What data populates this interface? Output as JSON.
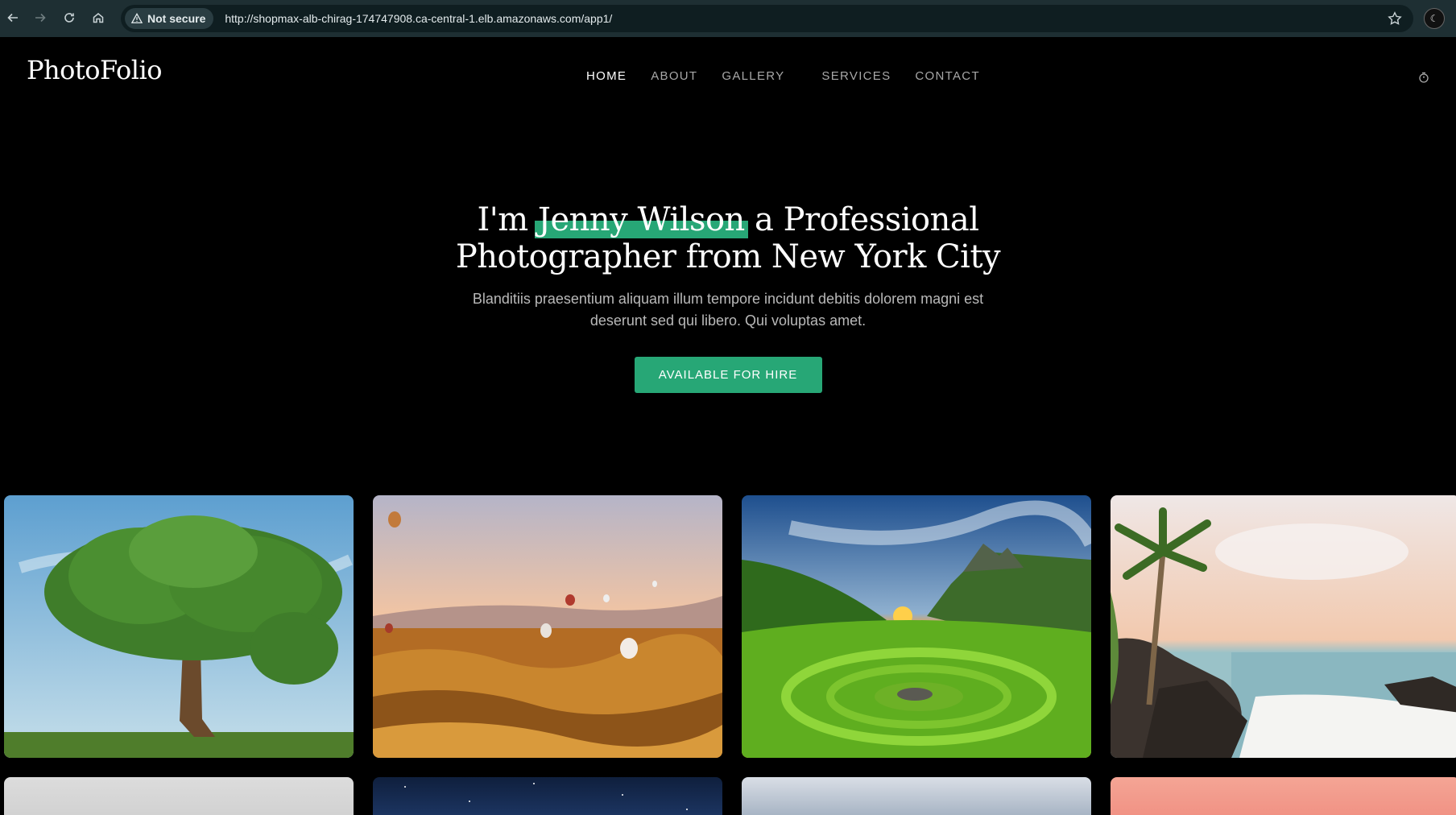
{
  "browser": {
    "security_label": "Not secure",
    "url": "http://shopmax-alb-chirag-174747908.ca-central-1.elb.amazonaws.com/app1/",
    "icons": [
      "back-icon",
      "forward-icon",
      "reload-icon",
      "home-icon",
      "warning-icon",
      "star-icon"
    ]
  },
  "site": {
    "logo": "PhotoFolio",
    "nav": [
      {
        "label": "HOME",
        "active": true
      },
      {
        "label": "ABOUT",
        "active": false
      },
      {
        "label": "GALLERY",
        "active": false
      },
      {
        "label": "SERVICES",
        "active": false
      },
      {
        "label": "CONTACT",
        "active": false
      }
    ]
  },
  "hero": {
    "title_prefix": "I'm ",
    "name": "Jenny Wilson",
    "title_suffix_line1": " a Professional",
    "title_line2": "Photographer from New York City",
    "description": "Blanditiis praesentium aliquam illum tempore incidunt debitis dolorem magni est deserunt sed qui libero. Qui voluptas amet.",
    "cta_label": "AVAILABLE FOR HIRE"
  },
  "colors": {
    "accent": "#27a776",
    "background": "#000000",
    "chrome": "#1e2f33"
  },
  "gallery": [
    {
      "subject": "tree"
    },
    {
      "subject": "hot-air-balloons"
    },
    {
      "subject": "green-valley-sunset"
    },
    {
      "subject": "palm-beach"
    },
    {
      "subject": "hazy-sky"
    },
    {
      "subject": "night-sky"
    },
    {
      "subject": "cloudy-sky"
    },
    {
      "subject": "pink-sky"
    }
  ]
}
